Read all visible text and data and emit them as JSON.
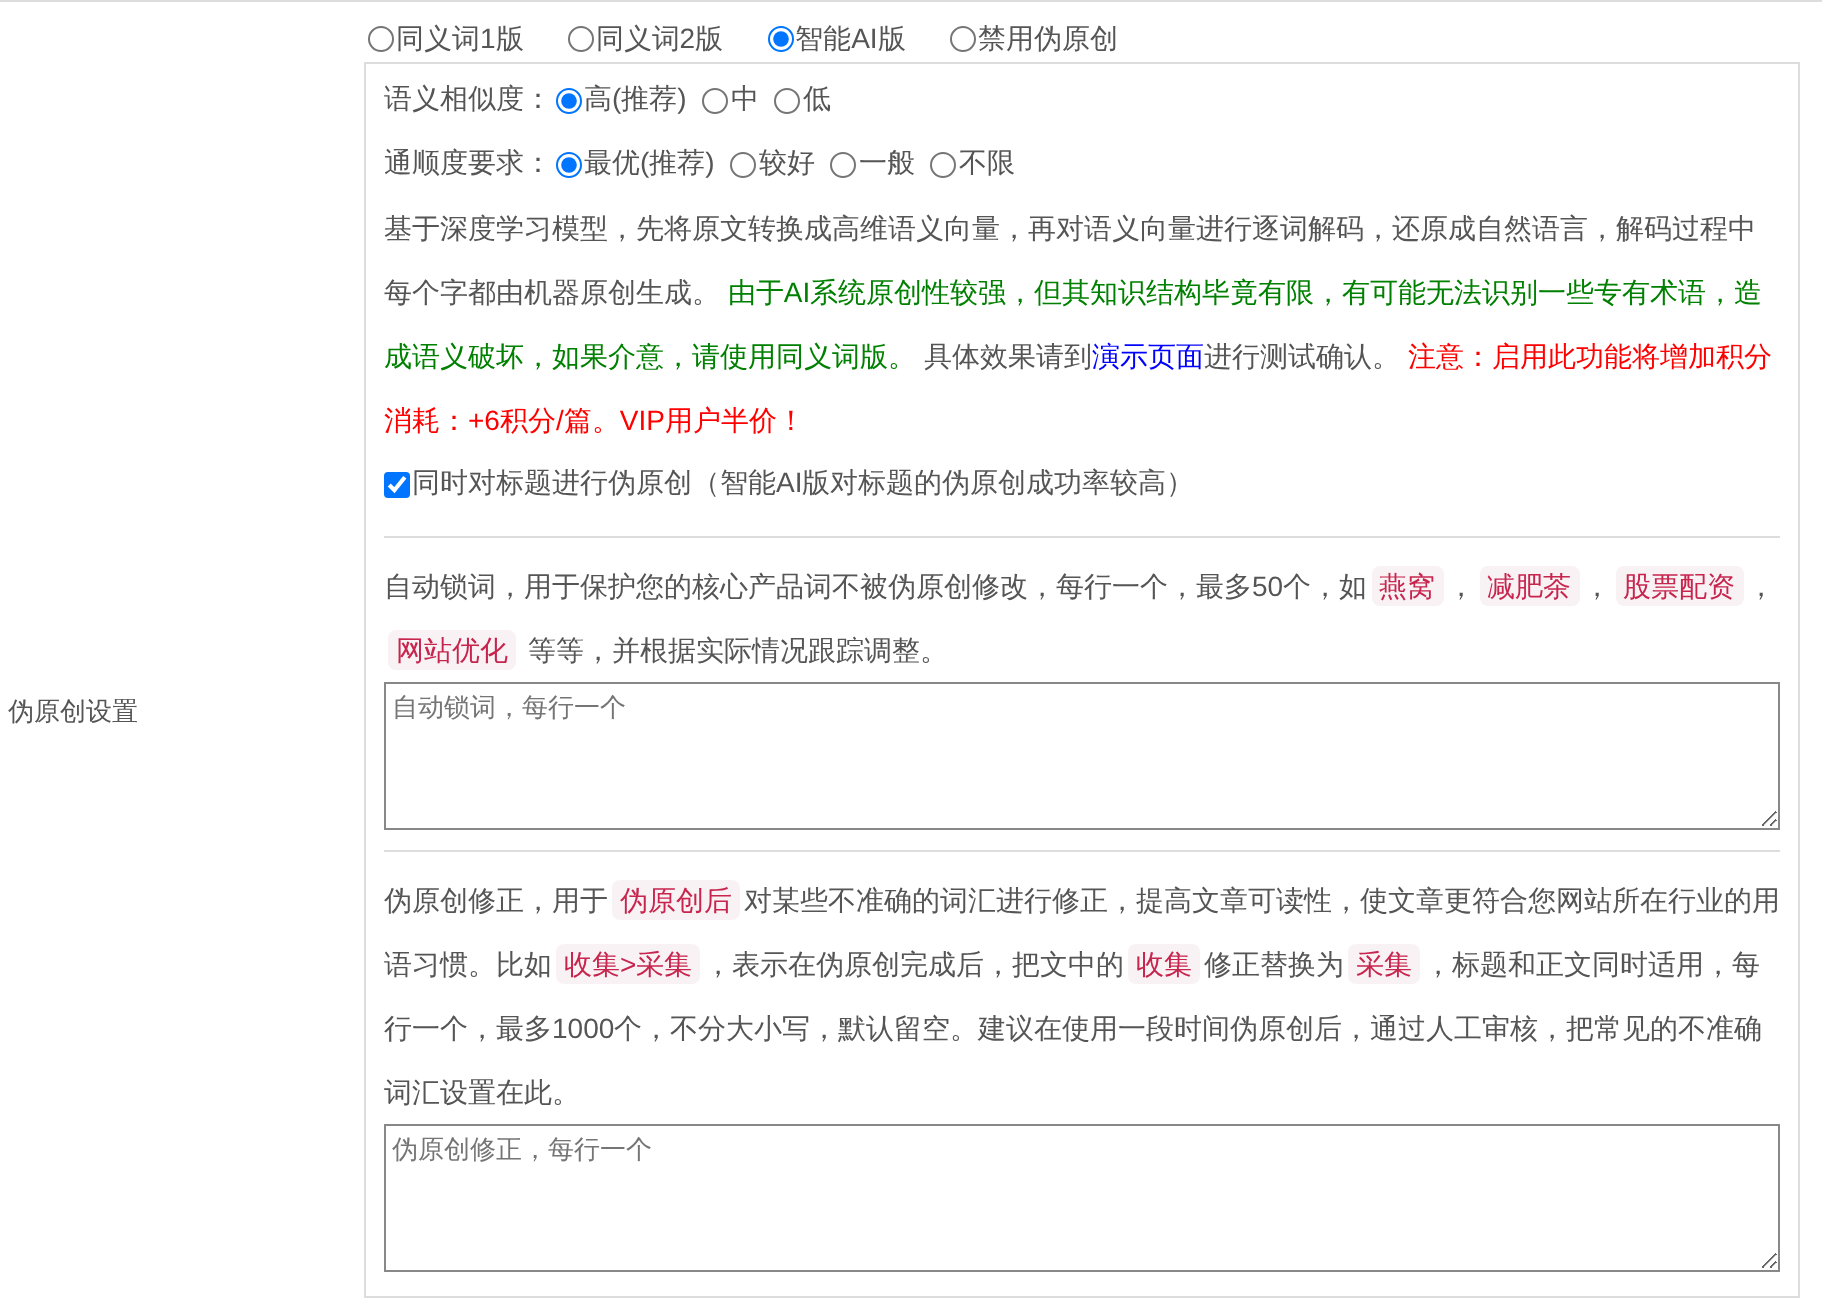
{
  "mode_options": [
    {
      "label": "同义词1版",
      "selected": false
    },
    {
      "label": "同义词2版",
      "selected": false
    },
    {
      "label": "智能AI版",
      "selected": true
    },
    {
      "label": "禁用伪原创",
      "selected": false
    }
  ],
  "settings_label": "伪原创设置",
  "similarity": {
    "label": "语义相似度：",
    "options": [
      {
        "label": "高(推荐)",
        "selected": true
      },
      {
        "label": "中",
        "selected": false
      },
      {
        "label": "低",
        "selected": false
      }
    ]
  },
  "fluency": {
    "label": "通顺度要求：",
    "options": [
      {
        "label": "最优(推荐)",
        "selected": true
      },
      {
        "label": "较好",
        "selected": false
      },
      {
        "label": "一般",
        "selected": false
      },
      {
        "label": "不限",
        "selected": false
      }
    ]
  },
  "description": [
    {
      "kind": "text",
      "text": "基于深度学习模型，先将原文转换成高维语义向量，再对语义向量进行逐词解码，还原成自然语言，解码过程中每个字都由机器原创生成。 "
    },
    {
      "kind": "green",
      "text": "由于AI系统原创性较强，但其知识结构毕竟有限，有可能无法识别一些专有术语，造成语义破坏，如果介意，请使用同义词版。"
    },
    {
      "kind": "text",
      "text": " 具体效果请到"
    },
    {
      "kind": "link",
      "text": "演示页面"
    },
    {
      "kind": "text",
      "text": "进行测试确认。 "
    },
    {
      "kind": "red",
      "text": "注意：启用此功能将增加积分消耗：+6积分/篇。VIP用户半价！"
    }
  ],
  "title_option": {
    "label": "同时对标题进行伪原创（智能AI版对标题的伪原创成功率较高）",
    "checked": true
  },
  "lock_words": {
    "description": [
      {
        "kind": "text",
        "text": "自动锁词，用于保护您的核心产品词不被伪原创修改，每行一个，最多50个，如"
      },
      {
        "kind": "code",
        "text": "燕窝"
      },
      {
        "kind": "text",
        "text": "，"
      },
      {
        "kind": "code",
        "text": "减肥茶"
      },
      {
        "kind": "text",
        "text": "，"
      },
      {
        "kind": "code",
        "text": "股票配资"
      },
      {
        "kind": "text",
        "text": "，"
      },
      {
        "kind": "code",
        "text": "网站优化"
      },
      {
        "kind": "text",
        "text": " 等等，并根据实际情况跟踪调整。"
      }
    ],
    "placeholder": "自动锁词，每行一个"
  },
  "correction": {
    "description": [
      {
        "kind": "text",
        "text": "伪原创修正，用于"
      },
      {
        "kind": "code",
        "text": "伪原创后"
      },
      {
        "kind": "text",
        "text": "对某些不准确的词汇进行修正，提高文章可读性，使文章更符合您网站所在行业的用语习惯。比如"
      },
      {
        "kind": "code",
        "text": "收集>采集"
      },
      {
        "kind": "text",
        "text": "，表示在伪原创完成后，把文中的"
      },
      {
        "kind": "code",
        "text": "收集"
      },
      {
        "kind": "text",
        "text": "修正替换为"
      },
      {
        "kind": "code",
        "text": "采集"
      },
      {
        "kind": "text",
        "text": "，标题和正文同时适用，每行一个，最多1000个，不分大小写，默认留空。建议在使用一段时间伪原创后，通过人工审核，把常见的不准确词汇设置在此。"
      }
    ],
    "placeholder": "伪原创修正，每行一个"
  }
}
